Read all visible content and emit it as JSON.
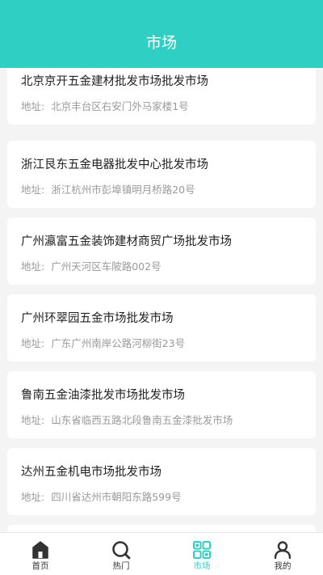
{
  "header": {
    "title": "市场"
  },
  "markets": [
    {
      "name": "北京京开五金建材批发市场批发市场",
      "address_label": "地址:",
      "address": "北京丰台区右安门外马家楼1号"
    },
    {
      "name": "浙江艮东五金电器批发中心批发市场",
      "address_label": "地址:",
      "address": "浙江杭州市彭埠镇明月桥路20号"
    },
    {
      "name": "广州瀛富五金装饰建材商贸广场批发市场",
      "address_label": "地址:",
      "address": "广州天河区车陂路002号"
    },
    {
      "name": "广州环翠园五金市场批发市场",
      "address_label": "地址:",
      "address": "广东广州南岸公路河柳街23号"
    },
    {
      "name": "鲁南五金油漆批发市场批发市场",
      "address_label": "地址:",
      "address": "山东省临西五路北段鲁南五金漆批发市场"
    },
    {
      "name": "达州五金机电市场批发市场",
      "address_label": "地址:",
      "address": "四川省达州市朝阳东路599号"
    }
  ],
  "tabbar": {
    "items": [
      {
        "label": "首页",
        "icon": "home-icon",
        "active": false
      },
      {
        "label": "热门",
        "icon": "search-icon",
        "active": false
      },
      {
        "label": "市场",
        "icon": "market-grid-icon",
        "active": true
      },
      {
        "label": "我的",
        "icon": "user-icon",
        "active": false
      }
    ]
  },
  "colors": {
    "accent": "#2fcfc4",
    "background": "#f4f4f4",
    "card": "#ffffff",
    "text_primary": "#222222",
    "text_secondary": "#9a9a9a",
    "icon_dark": "#333333"
  }
}
